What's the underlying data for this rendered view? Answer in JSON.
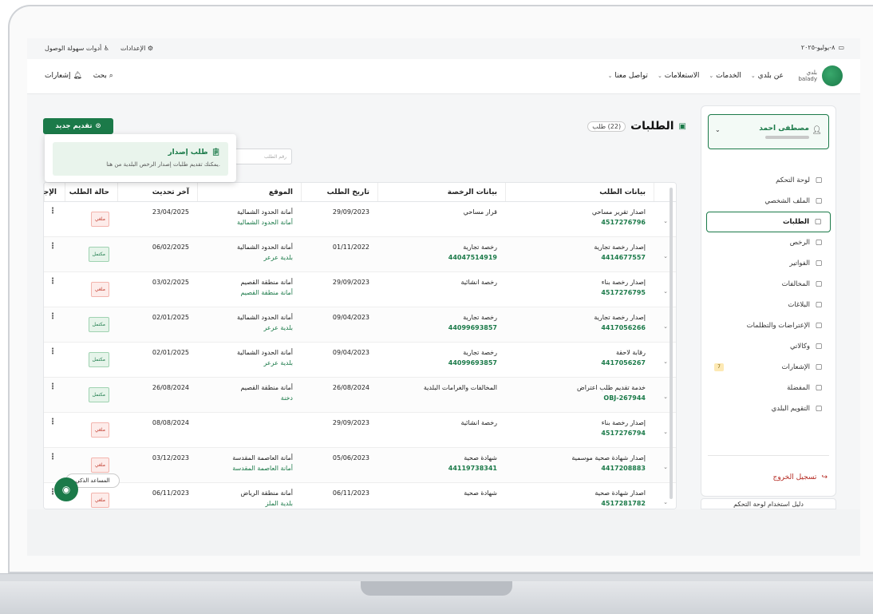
{
  "topbar": {
    "date": "٨-يوليو-٢٠٢٥",
    "accessibility": "أدوات سهولة الوصول",
    "settings": "الإعدادات"
  },
  "nav": {
    "logo_text": "بلدي",
    "logo_sub": "balady",
    "menu": [
      "عن بلدي",
      "الخدمات",
      "الاستعلامات",
      "تواصل معنا"
    ],
    "search": "بحث",
    "notifications": "إشعارات"
  },
  "sidebar": {
    "user_name": "مصطفى احمد",
    "items": [
      {
        "label": "لوحة التحكم",
        "icon": "dashboard-icon"
      },
      {
        "label": "الملف الشخصي",
        "icon": "profile-icon"
      },
      {
        "label": "الطلبات",
        "icon": "requests-icon"
      },
      {
        "label": "الرخص",
        "icon": "license-icon"
      },
      {
        "label": "الفواتير",
        "icon": "invoice-icon"
      },
      {
        "label": "المخالفات",
        "icon": "violation-icon"
      },
      {
        "label": "البلاغات",
        "icon": "report-icon"
      },
      {
        "label": "الإعتراضات والتظلمات",
        "icon": "objection-icon"
      },
      {
        "label": "وكالاتي",
        "icon": "agency-icon"
      },
      {
        "label": "الإشعارات",
        "icon": "bell-icon",
        "count": "7"
      },
      {
        "label": "المفضلة",
        "icon": "favorite-icon"
      },
      {
        "label": "التقويم البلدي",
        "icon": "calendar-icon"
      }
    ],
    "logout": "تسجيل الخروج",
    "guide": "دليل استخدام لوحة التحكم"
  },
  "main": {
    "title": "الطلبات",
    "count": "(22) طلب",
    "new_button": "تقديم جديد",
    "search_placeholder": "رقم الطلب",
    "popup_title": "طلب إصدار",
    "popup_desc": "يمكنك تقديم طلبات إصدار الرخص البلدية من هنا."
  },
  "table": {
    "headers": [
      "بيانات الطلب",
      "بيانات الرخصة",
      "تاريخ الطلب",
      "الموقع",
      "آخر تحديث",
      "حالة الطلب",
      "الإجراء"
    ],
    "rows": [
      {
        "req": "اصدار تقرير مساحي",
        "req_no": "4517276796",
        "lic": "قرار مساحي",
        "lic_no": "",
        "date": "29/09/2023",
        "loc1": "أمانة الحدود الشمالية",
        "loc2": "أمانة الحدود الشمالية",
        "upd": "23/04/2025",
        "status": "ملغي",
        "status_type": "cancel"
      },
      {
        "req": "إصدار رخصة تجارية",
        "req_no": "4414677557",
        "lic": "رخصة تجارية",
        "lic_no": "44047514919",
        "date": "01/11/2022",
        "loc1": "أمانة الحدود الشمالية",
        "loc2": "بلدية عرعر",
        "upd": "06/02/2025",
        "status": "مكتمل",
        "status_type": "done"
      },
      {
        "req": "إصدار رخصة بناء",
        "req_no": "4517276795",
        "lic": "رخصة انشائية",
        "lic_no": "",
        "date": "29/09/2023",
        "loc1": "أمانة منطقة القصيم",
        "loc2": "أمانة منطقة القصيم",
        "upd": "03/02/2025",
        "status": "ملغي",
        "status_type": "cancel"
      },
      {
        "req": "إصدار رخصة تجارية",
        "req_no": "4417056266",
        "lic": "رخصة تجارية",
        "lic_no": "44099693857",
        "date": "09/04/2023",
        "loc1": "أمانة الحدود الشمالية",
        "loc2": "بلدية عرعر",
        "upd": "02/01/2025",
        "status": "مكتمل",
        "status_type": "done"
      },
      {
        "req": "رقابة لاحقة",
        "req_no": "4417056267",
        "lic": "رخصة تجارية",
        "lic_no": "44099693857",
        "date": "09/04/2023",
        "loc1": "أمانة الحدود الشمالية",
        "loc2": "بلدية عرعر",
        "upd": "02/01/2025",
        "status": "مكتمل",
        "status_type": "done"
      },
      {
        "req": "خدمة تقديم طلب اعتراض",
        "req_no": "OBJ-267944",
        "lic": "المخالفات والغرامات البلدية",
        "lic_no": "",
        "date": "26/08/2024",
        "loc1": "أمانة منطقة القصيم",
        "loc2": "دخنة",
        "upd": "26/08/2024",
        "status": "مكتمل",
        "status_type": "done"
      },
      {
        "req": "إصدار رخصة بناء",
        "req_no": "4517276794",
        "lic": "رخصة انشائية",
        "lic_no": "",
        "date": "29/09/2023",
        "loc1": "",
        "loc2": "",
        "upd": "08/08/2024",
        "status": "ملغي",
        "status_type": "cancel"
      },
      {
        "req": "إصدار شهادة صحية موسمية",
        "req_no": "4417208883",
        "lic": "شهادة صحية",
        "lic_no": "44119738341",
        "date": "05/06/2023",
        "loc1": "أمانة العاصمة المقدسة",
        "loc2": "أمانة العاصمة المقدسة",
        "upd": "03/12/2023",
        "status": "ملغي",
        "status_type": "cancel"
      },
      {
        "req": "اصدار شهادة صحية",
        "req_no": "4517281782",
        "lic": "شهادة صحية",
        "lic_no": "",
        "date": "06/11/2023",
        "loc1": "أمانة منطقة الرياض",
        "loc2": "بلدية الملز",
        "upd": "06/11/2023",
        "status": "ملغي",
        "status_type": "cancel"
      }
    ]
  },
  "assistant": {
    "label": "المساعد الذكي"
  },
  "colors": {
    "brand": "#1b7a49",
    "cancel": "#c0392b"
  }
}
